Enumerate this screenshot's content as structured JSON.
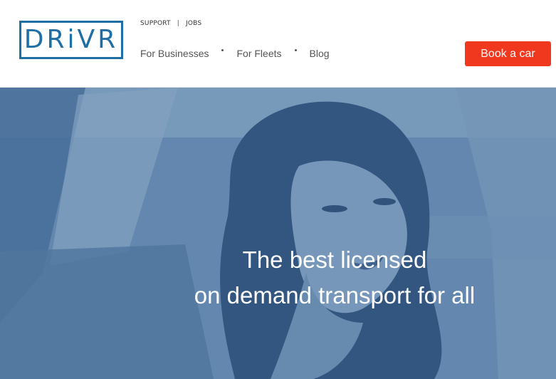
{
  "brand": {
    "logo_text": "DRiVR",
    "color": "#1f6ea6"
  },
  "utility_nav": {
    "support": "SUPPORT",
    "separator": "|",
    "jobs": "JOBS"
  },
  "main_nav": {
    "items": [
      "For Businesses",
      "For Fleets",
      "Blog"
    ]
  },
  "cta": {
    "label": "Book a car",
    "color": "#f0381f"
  },
  "hero": {
    "headline_line1": "The best licensed",
    "headline_line2": "on demand transport for all",
    "overlay_color": "#4f76a1"
  }
}
